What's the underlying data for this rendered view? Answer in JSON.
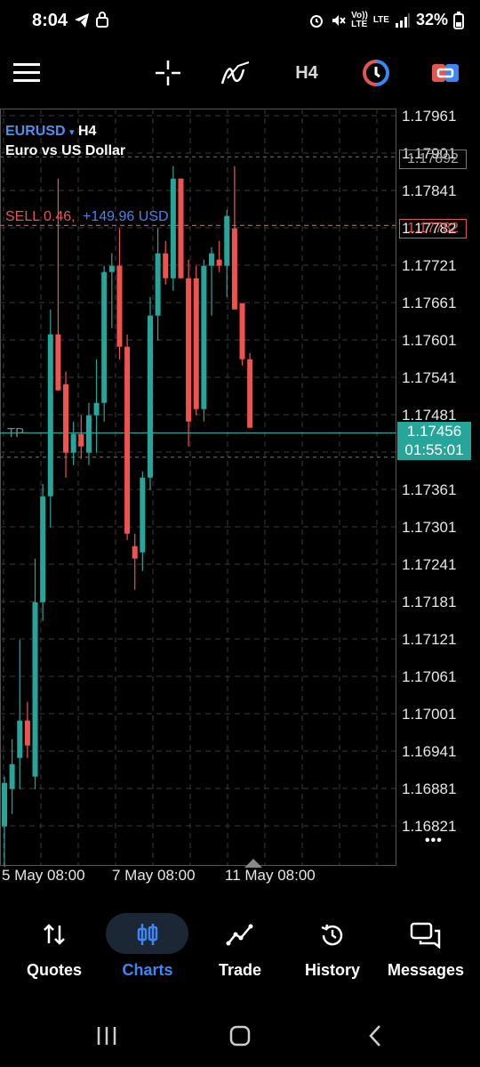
{
  "status": {
    "time": "8:04",
    "network_top": "Vo))",
    "network_bottom": "LTE",
    "lte": "LTE",
    "battery": "32%"
  },
  "toolbar": {
    "timeframe": "H4",
    "icons": [
      "menu-icon",
      "crosshair-icon",
      "indicators-icon",
      "timeframe",
      "one-click-trade-icon",
      "new-order-icon"
    ]
  },
  "symbol": {
    "name": "EURUSD",
    "arrow": "▾",
    "timeframe": "H4",
    "description": "Euro vs US Dollar"
  },
  "order": {
    "side_volume": "SELL 0.46,",
    "profit": "+149.96 USD",
    "open_price": "1.17782",
    "tp_label": "TP",
    "bid_price": "1.17892"
  },
  "current": {
    "price": "1.17456",
    "countdown": "01:55:01"
  },
  "price_axis": [
    "1.17961",
    "1.17901",
    "1.17841",
    "1.17782",
    "1.17721",
    "1.17661",
    "1.17601",
    "1.17541",
    "1.17481",
    "1.17421",
    "1.17361",
    "1.17301",
    "1.17241",
    "1.17181",
    "1.17121",
    "1.17061",
    "1.17001",
    "1.16941",
    "1.16881",
    "1.16821"
  ],
  "time_axis": [
    "5 May 08:00",
    "7 May 08:00",
    "11 May 08:00"
  ],
  "more": "•••",
  "colors": {
    "bull": "#26a69a",
    "bear": "#ef5350",
    "accent": "#3e86f5",
    "sell_line": "#e0574f",
    "tp_line": "#26a69a"
  },
  "candles": [
    {
      "o": 1.1682,
      "h": 1.169,
      "l": 1.167,
      "c": 1.1689
    },
    {
      "o": 1.1688,
      "h": 1.1696,
      "l": 1.1684,
      "c": 1.1692
    },
    {
      "o": 1.1693,
      "h": 1.1712,
      "l": 1.1688,
      "c": 1.1699
    },
    {
      "o": 1.1699,
      "h": 1.1702,
      "l": 1.1693,
      "c": 1.1695
    },
    {
      "o": 1.169,
      "h": 1.1725,
      "l": 1.1688,
      "c": 1.1718
    },
    {
      "o": 1.1718,
      "h": 1.1737,
      "l": 1.1715,
      "c": 1.1735
    },
    {
      "o": 1.1735,
      "h": 1.1765,
      "l": 1.173,
      "c": 1.1761
    },
    {
      "o": 1.1761,
      "h": 1.1786,
      "l": 1.1753,
      "c": 1.1752
    },
    {
      "o": 1.1753,
      "h": 1.1755,
      "l": 1.1738,
      "c": 1.1742
    },
    {
      "o": 1.1742,
      "h": 1.1747,
      "l": 1.174,
      "c": 1.1745
    },
    {
      "o": 1.1745,
      "h": 1.1748,
      "l": 1.1741,
      "c": 1.1743
    },
    {
      "o": 1.1742,
      "h": 1.175,
      "l": 1.174,
      "c": 1.1748
    },
    {
      "o": 1.1748,
      "h": 1.1757,
      "l": 1.1742,
      "c": 1.175
    },
    {
      "o": 1.175,
      "h": 1.1772,
      "l": 1.1747,
      "c": 1.1771
    },
    {
      "o": 1.1771,
      "h": 1.1774,
      "l": 1.1762,
      "c": 1.1772
    },
    {
      "o": 1.1772,
      "h": 1.1778,
      "l": 1.1757,
      "c": 1.1759
    },
    {
      "o": 1.1759,
      "h": 1.1761,
      "l": 1.1728,
      "c": 1.1729
    },
    {
      "o": 1.1727,
      "h": 1.1729,
      "l": 1.172,
      "c": 1.1725
    },
    {
      "o": 1.1726,
      "h": 1.1739,
      "l": 1.1723,
      "c": 1.1738
    },
    {
      "o": 1.1738,
      "h": 1.1767,
      "l": 1.1736,
      "c": 1.1764
    },
    {
      "o": 1.1764,
      "h": 1.1778,
      "l": 1.176,
      "c": 1.1774
    },
    {
      "o": 1.1774,
      "h": 1.1776,
      "l": 1.1769,
      "c": 1.177
    },
    {
      "o": 1.177,
      "h": 1.1788,
      "l": 1.1768,
      "c": 1.1786
    },
    {
      "o": 1.1786,
      "h": 1.1782,
      "l": 1.177,
      "c": 1.177
    },
    {
      "o": 1.177,
      "h": 1.1773,
      "l": 1.1743,
      "c": 1.1747
    },
    {
      "o": 1.177,
      "h": 1.1772,
      "l": 1.1748,
      "c": 1.1749
    },
    {
      "o": 1.1749,
      "h": 1.1773,
      "l": 1.1747,
      "c": 1.1772
    },
    {
      "o": 1.1772,
      "h": 1.1775,
      "l": 1.1764,
      "c": 1.1774
    },
    {
      "o": 1.1773,
      "h": 1.1776,
      "l": 1.1771,
      "c": 1.1772
    },
    {
      "o": 1.1772,
      "h": 1.1781,
      "l": 1.1767,
      "c": 1.178
    },
    {
      "o": 1.1778,
      "h": 1.1788,
      "l": 1.1766,
      "c": 1.1765
    },
    {
      "o": 1.1766,
      "h": 1.1764,
      "l": 1.1756,
      "c": 1.1757
    },
    {
      "o": 1.1757,
      "h": 1.1758,
      "l": 1.1746,
      "c": 1.1746
    }
  ],
  "nav": {
    "items": [
      {
        "label": "Quotes"
      },
      {
        "label": "Charts"
      },
      {
        "label": "Trade"
      },
      {
        "label": "History"
      },
      {
        "label": "Messages"
      }
    ],
    "active": 1
  }
}
